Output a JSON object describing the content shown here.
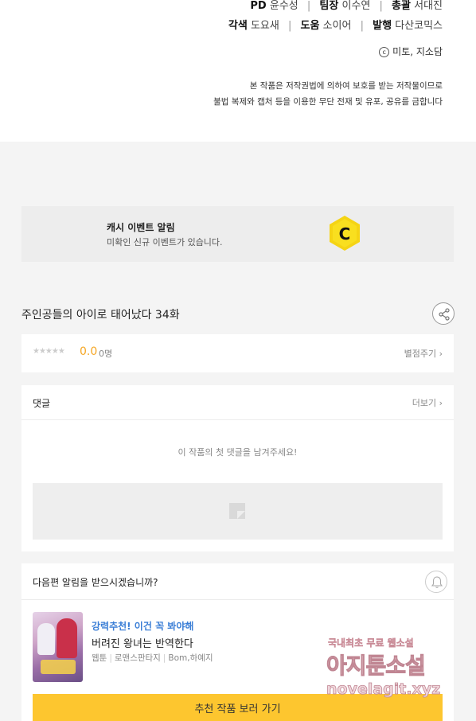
{
  "credits": {
    "pd_label": "PD",
    "pd_value": "윤수성",
    "lead_label": "팀장",
    "lead_value": "이수연",
    "chief_label": "총괄",
    "chief_value": "서대진",
    "adapt_label": "각색",
    "adapt_value": "도요새",
    "assist_label": "도움",
    "assist_value": "소이어",
    "publisher_label": "발행",
    "publisher_value": "다산코믹스",
    "copyright_symbol": "c",
    "copyright_text": "미토, 지소담",
    "notice_line1": "본 작품은 저작권법에 의하여 보호를 받는 저작물이므로",
    "notice_line2": "불법 복제와 캡처 등을 이용한 무단 전재 및 유포, 공유를 금합니다"
  },
  "cash_banner": {
    "title": "캐시 이벤트 알림",
    "subtitle": "미확인 신규 이벤트가 있습니다.",
    "coin_letter": "C",
    "coin_color": "#f5d414"
  },
  "episode": {
    "title": "주인공들의 아이로 태어났다 34화",
    "share_icon": "share-icon"
  },
  "rating": {
    "stars": "★★★★★",
    "score": "0.0",
    "count": "0명",
    "rate_label": "별점주기 ›"
  },
  "comments": {
    "label": "댓글",
    "more_label": "더보기 ›",
    "empty_message": "이 작품의 첫 댓글을 남겨주세요!"
  },
  "alarm": {
    "question": "다음편 알림을 받으시겠습니까?",
    "bell_icon": "bell-icon"
  },
  "recommendation": {
    "tag": "강력추천! 이건 꼭 봐야해",
    "title": "버려진 왕녀는 반역한다",
    "type": "웹툰",
    "genre": "로맨스판타지",
    "authors": "Bom,하예지",
    "button_label": "추천 작품 보러 가기",
    "button_color": "#fdc62f"
  },
  "watermark": {
    "line1": "국내최초 무료 웹소설",
    "line2": "아지툰소설",
    "line3": "novelagit.xyz"
  }
}
